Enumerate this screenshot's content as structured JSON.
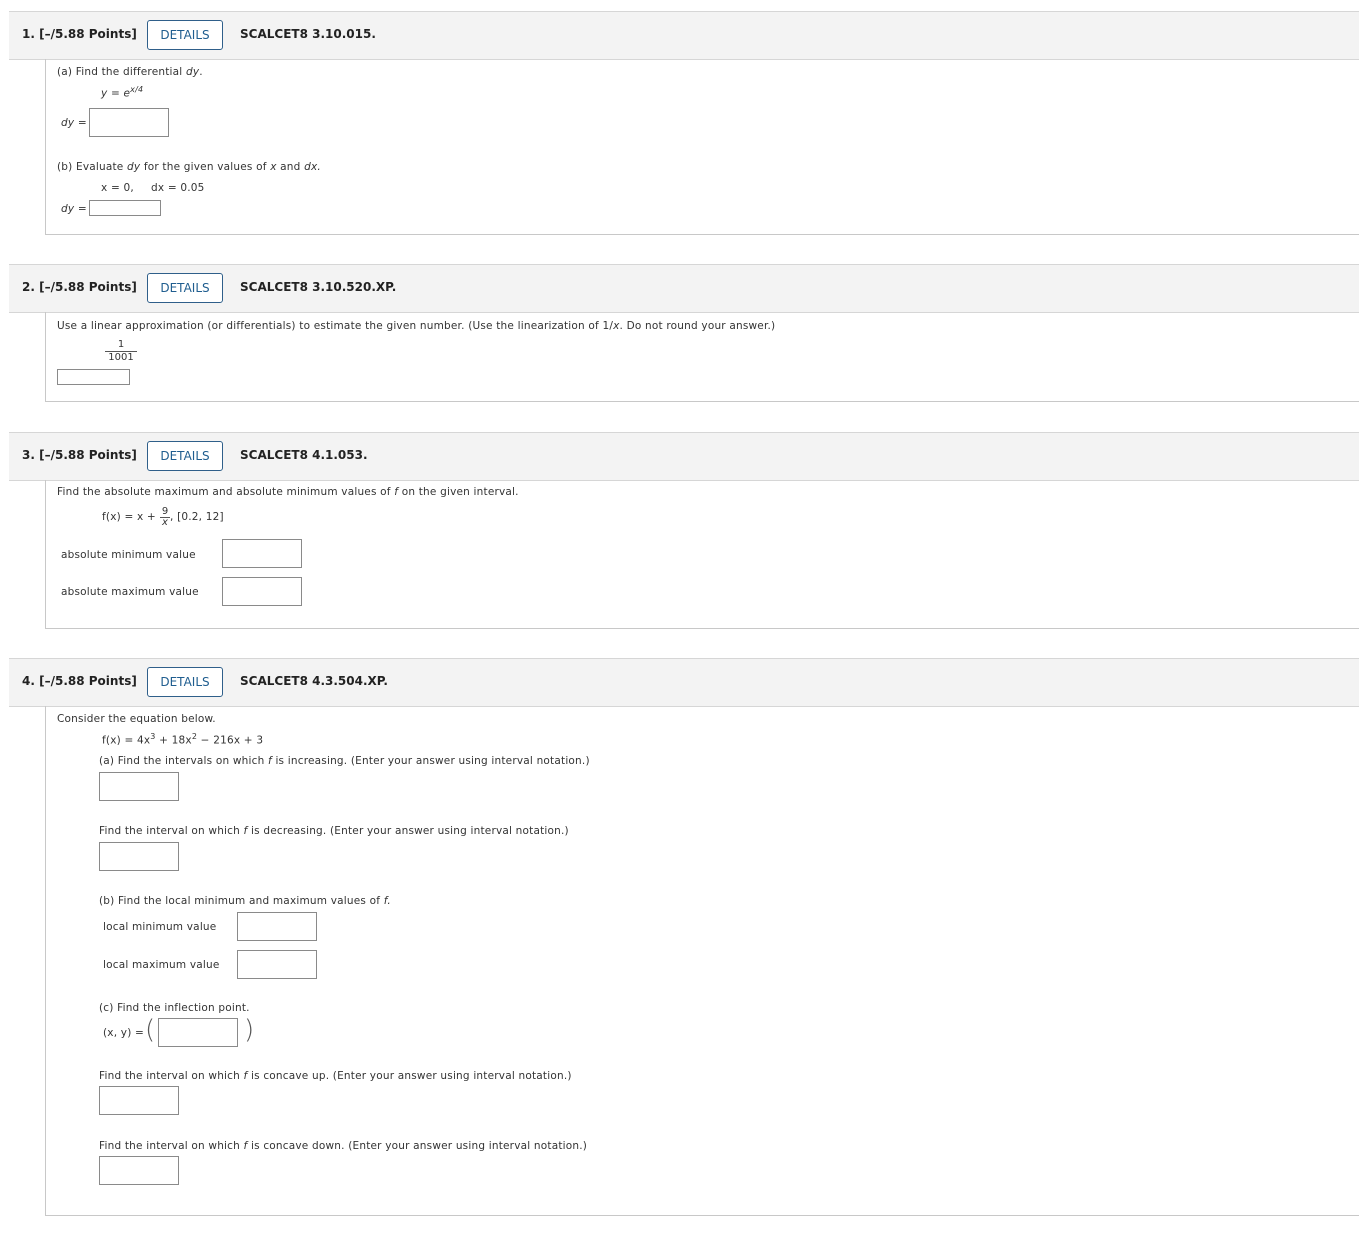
{
  "questions": [
    {
      "number": "1.",
      "points": "[–/5.88 Points]",
      "details_label": "DETAILS",
      "code": "SCALCET8 3.10.015."
    },
    {
      "number": "2.",
      "points": "[–/5.88 Points]",
      "details_label": "DETAILS",
      "code": "SCALCET8 3.10.520.XP."
    },
    {
      "number": "3.",
      "points": "[–/5.88 Points]",
      "details_label": "DETAILS",
      "code": "SCALCET8 4.1.053."
    },
    {
      "number": "4.",
      "points": "[–/5.88 Points]",
      "details_label": "DETAILS",
      "code": "SCALCET8 4.3.504.XP."
    }
  ],
  "q1": {
    "part_a": "(a) Find the differential",
    "part_a_var": "dy",
    "y_eq": "y = e",
    "y_exp": "x/4",
    "dy_label": "dy =",
    "part_b_pre": "(b) Evaluate",
    "part_b_dy": "dy",
    "part_b_mid": "for the given values of",
    "part_b_x": "x",
    "part_b_and": "and",
    "part_b_dx": "dx.",
    "given_x": "x = 0,",
    "given_dx": "dx = 0.05",
    "dy_label_b": "dy ="
  },
  "q2": {
    "prompt_pre": "Use a linear approximation (or differentials) to estimate the given number. (Use the linearization of 1/",
    "prompt_x": "x",
    "prompt_post": ". Do not round your answer.)",
    "numerator": "1",
    "denominator": "1001"
  },
  "q3": {
    "prompt_pre": "Find the absolute maximum and absolute minimum values of",
    "prompt_f": "f",
    "prompt_post": "on the given interval.",
    "fx": "f(x) = x +",
    "frac_num": "9",
    "frac_den": "x",
    "interval": ",  [0.2, 12]",
    "min_label": "absolute minimum value",
    "max_label": "absolute maximum value"
  },
  "q4": {
    "intro": "Consider the equation below.",
    "fx_pre": "f(x) = 4x",
    "fx_exp1": "3",
    "fx_mid": " + 18x",
    "fx_exp2": "2",
    "fx_post": " − 216x + 3",
    "a_pre": "(a) Find the intervals on which",
    "a_f": "f",
    "a_post": "is increasing. (Enter your answer using interval notation.)",
    "dec_pre": "Find the interval on which",
    "dec_f": "f",
    "dec_post": "is decreasing. (Enter your answer using interval notation.)",
    "b_pre": "(b) Find the local minimum and maximum values of",
    "b_f": "f.",
    "local_min_label": "local minimum value",
    "local_max_label": "local maximum value",
    "c_text": "(c) Find the inflection point.",
    "xy_label": "(x, y) =",
    "up_pre": "Find the interval on which",
    "up_f": "f",
    "up_post": "is concave up. (Enter your answer using interval notation.)",
    "down_pre": "Find the interval on which",
    "down_f": "f",
    "down_post": "is concave down. (Enter your answer using interval notation.)"
  }
}
